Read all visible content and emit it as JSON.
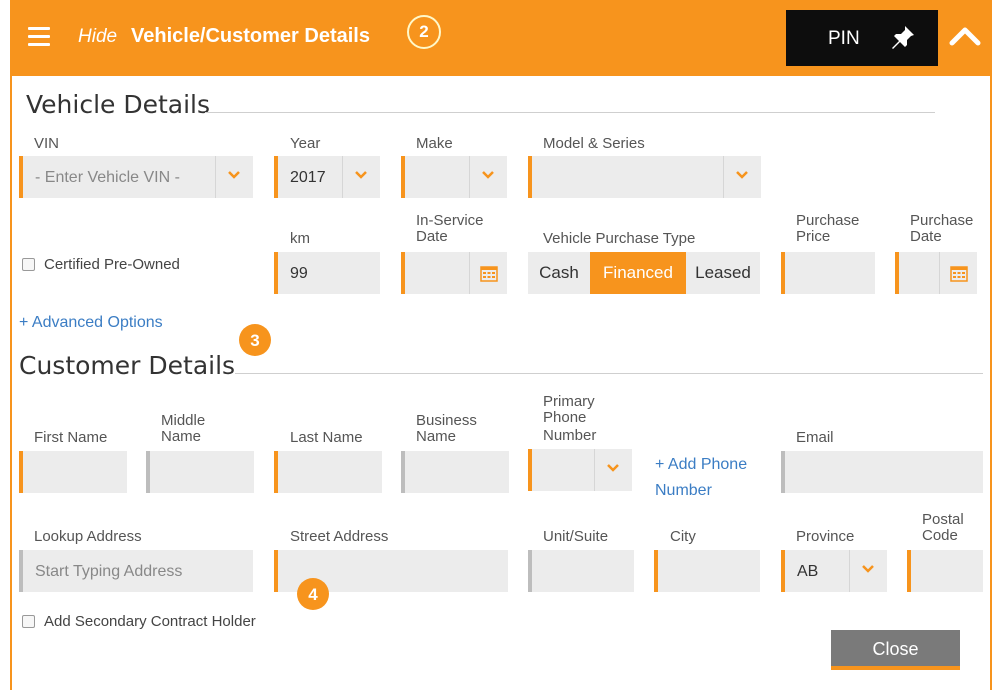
{
  "header": {
    "hide_label": "Hide",
    "title": "Vehicle/Customer Details",
    "pin_label": "PIN",
    "accent": "#f7941d"
  },
  "badges": {
    "b2": "2",
    "b3": "3",
    "b4": "4"
  },
  "vehicle": {
    "section_title": "Vehicle Details",
    "vin_label": "VIN",
    "vin_placeholder": "- Enter Vehicle VIN -",
    "year_label": "Year",
    "year_value": "2017",
    "make_label": "Make",
    "model_label": "Model & Series",
    "certified_label": "Certified Pre-Owned",
    "km_label": "km",
    "km_value": "99",
    "inservice_label_1": "In-Service",
    "inservice_label_2": "Date",
    "purchase_type_label": "Vehicle Purchase Type",
    "purchase_types": [
      "Cash",
      "Financed",
      "Leased"
    ],
    "purchase_type_selected": "Financed",
    "purchase_price_label_1": "Purchase",
    "purchase_price_label_2": "Price",
    "purchase_date_label_1": "Purchase",
    "purchase_date_label_2": "Date",
    "advanced_link": "+ Advanced Options"
  },
  "customer": {
    "section_title": "Customer Details",
    "first_name_label": "First Name",
    "middle_label_1": "Middle",
    "middle_label_2": "Name",
    "last_name_label": "Last Name",
    "business_label_1": "Business",
    "business_label_2": "Name",
    "phone_label_1": "Primary",
    "phone_label_2": "Phone",
    "phone_label_3": "Number",
    "add_phone_1": "+ Add Phone",
    "add_phone_2": "Number",
    "email_label": "Email",
    "lookup_label": "Lookup Address",
    "lookup_placeholder": "Start Typing Address",
    "street_label": "Street Address",
    "unit_label": "Unit/Suite",
    "city_label": "City",
    "province_label": "Province",
    "province_value": "AB",
    "postal_label_1": "Postal",
    "postal_label_2": "Code",
    "secondary_label": "Add Secondary Contract Holder"
  },
  "footer": {
    "close_label": "Close"
  }
}
